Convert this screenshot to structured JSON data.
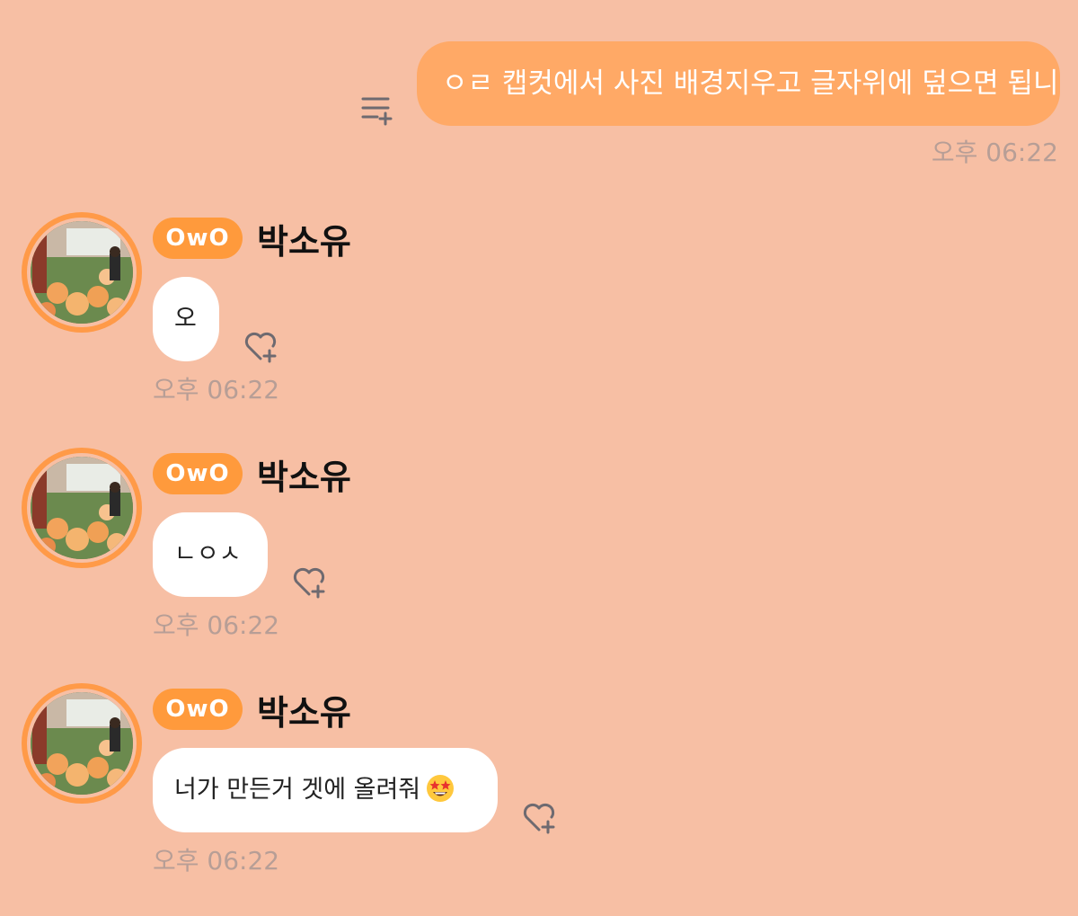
{
  "outgoing": {
    "text": "ㅇㄹ 캡컷에서 사진 배경지우고 글자위에 덮으면 됩니다",
    "time": "오후 06:22",
    "action_icon": "add-to-list-icon"
  },
  "messages": [
    {
      "badge": "OwO",
      "sender": "박소유",
      "text": "오",
      "time": "오후 06:22",
      "reaction_icon": "heart-plus-icon"
    },
    {
      "badge": "OwO",
      "sender": "박소유",
      "text": "ㄴㅇㅅ",
      "time": "오후 06:22",
      "reaction_icon": "heart-plus-icon"
    },
    {
      "badge": "OwO",
      "sender": "박소유",
      "text": "너가 만든거 겟에 올려줘",
      "emoji": "star-struck-emoji-icon",
      "time": "오후 06:22",
      "reaction_icon": "heart-plus-icon"
    }
  ],
  "colors": {
    "background": "#F7BFA4",
    "outgoing_bubble": "#FFA966",
    "incoming_bubble": "#FFFFFF",
    "badge": "#FF9A3C",
    "avatar_ring": "#FF9A48",
    "timestamp": "#B79E96"
  }
}
